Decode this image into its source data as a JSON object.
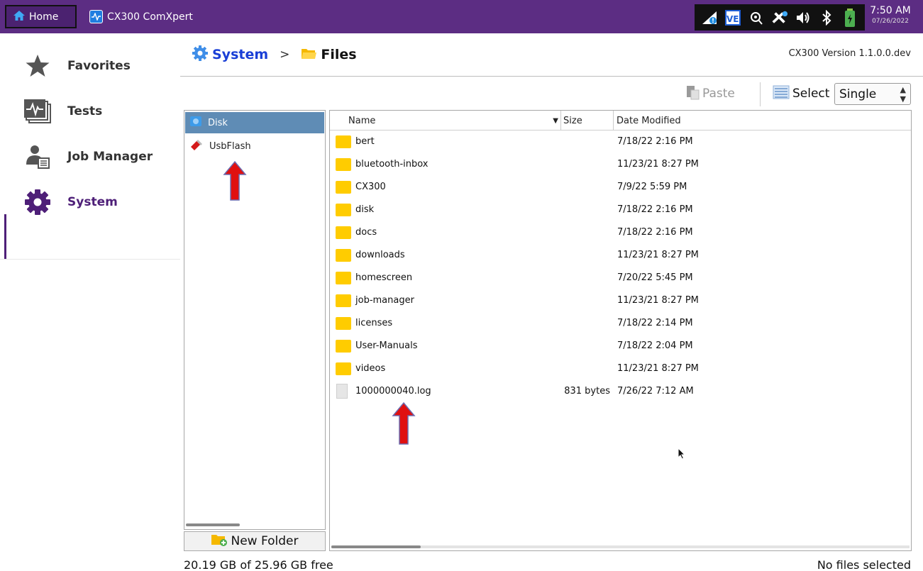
{
  "topbar": {
    "home_label": "Home",
    "app_title": "CX300 ComXpert",
    "status_icons": [
      "network-warning-icon",
      "ve-icon",
      "location-search-icon",
      "tools-icon",
      "speaker-icon",
      "bluetooth-icon",
      "battery-charging-icon"
    ],
    "ve_label": "VE",
    "clock_time": "7:50 AM",
    "clock_date": "07/26/2022"
  },
  "sidebar": {
    "items": [
      {
        "label": "Favorites",
        "icon": "star-icon"
      },
      {
        "label": "Tests",
        "icon": "tests-icon"
      },
      {
        "label": "Job Manager",
        "icon": "job-manager-icon"
      },
      {
        "label": "System",
        "icon": "gear-icon",
        "active": true
      }
    ]
  },
  "breadcrumb": {
    "system": "System",
    "separator": ">",
    "files": "Files"
  },
  "version": "CX300 Version 1.1.0.0.dev",
  "toolbar": {
    "paste_label": "Paste",
    "select_label": "Select",
    "select_value": "Single"
  },
  "drives": [
    {
      "label": "Disk",
      "selected": true
    },
    {
      "label": "UsbFlash",
      "selected": false
    }
  ],
  "new_folder_label": "New Folder",
  "file_table": {
    "headers": {
      "name": "Name",
      "size": "Size",
      "date": "Date Modified"
    },
    "rows": [
      {
        "name": "bert",
        "size": "",
        "date": "7/18/22 2:16 PM",
        "type": "folder"
      },
      {
        "name": "bluetooth-inbox",
        "size": "",
        "date": "11/23/21 8:27 PM",
        "type": "folder"
      },
      {
        "name": "CX300",
        "size": "",
        "date": "7/9/22 5:59 PM",
        "type": "folder"
      },
      {
        "name": "disk",
        "size": "",
        "date": "7/18/22 2:16 PM",
        "type": "folder"
      },
      {
        "name": "docs",
        "size": "",
        "date": "7/18/22 2:16 PM",
        "type": "folder"
      },
      {
        "name": "downloads",
        "size": "",
        "date": "11/23/21 8:27 PM",
        "type": "folder"
      },
      {
        "name": "homescreen",
        "size": "",
        "date": "7/20/22 5:45 PM",
        "type": "folder"
      },
      {
        "name": "job-manager",
        "size": "",
        "date": "11/23/21 8:27 PM",
        "type": "folder"
      },
      {
        "name": "licenses",
        "size": "",
        "date": "7/18/22 2:14 PM",
        "type": "folder"
      },
      {
        "name": "User-Manuals",
        "size": "",
        "date": "7/18/22 2:04 PM",
        "type": "folder"
      },
      {
        "name": "videos",
        "size": "",
        "date": "11/23/21 8:27 PM",
        "type": "folder"
      },
      {
        "name": "1000000040.log",
        "size": "831 bytes",
        "date": "7/26/22 7:12 AM",
        "type": "file"
      }
    ]
  },
  "footer": {
    "free_space": "20.19 GB of 25.96 GB free",
    "selection": "No files selected"
  }
}
